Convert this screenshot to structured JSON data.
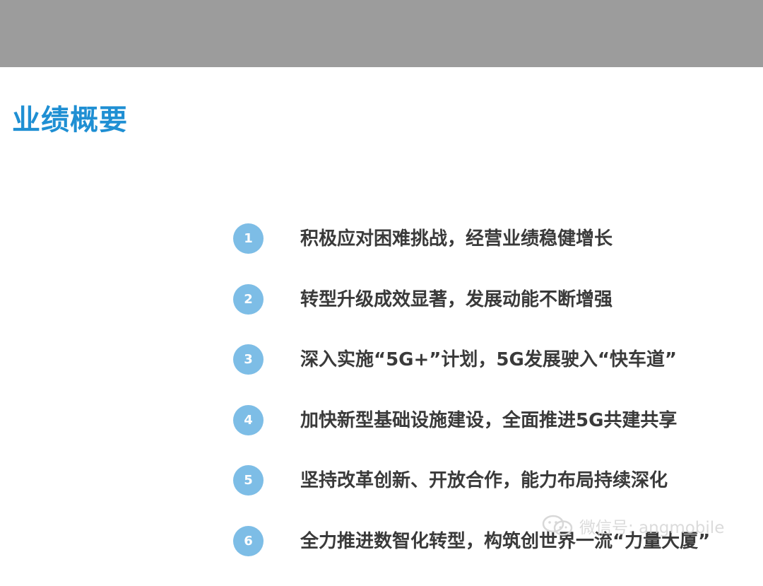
{
  "slide": {
    "title": "业绩概要",
    "items": [
      {
        "number": "1",
        "text": "积极应对困难挑战，经营业绩稳健增长"
      },
      {
        "number": "2",
        "text": "转型升级成效显著，发展动能不断增强"
      },
      {
        "number": "3",
        "text": "深入实施“5G+”计划，5G发展驶入“快车道”"
      },
      {
        "number": "4",
        "text": "加快新型基础设施建设，全面推进5G共建共享"
      },
      {
        "number": "5",
        "text": "坚持改革创新、开放合作，能力布局持续深化"
      },
      {
        "number": "6",
        "text": "全力推进数智化转型，构筑创世界一流“力量大厦”"
      }
    ]
  },
  "watermark": {
    "text": "微信号: angmobile",
    "icon": "wechat-icon"
  },
  "colors": {
    "top_band": "#9c9c9c",
    "title": "#1f8fd3",
    "circle": "#7dbde6",
    "item_text": "#3a3a3a"
  }
}
